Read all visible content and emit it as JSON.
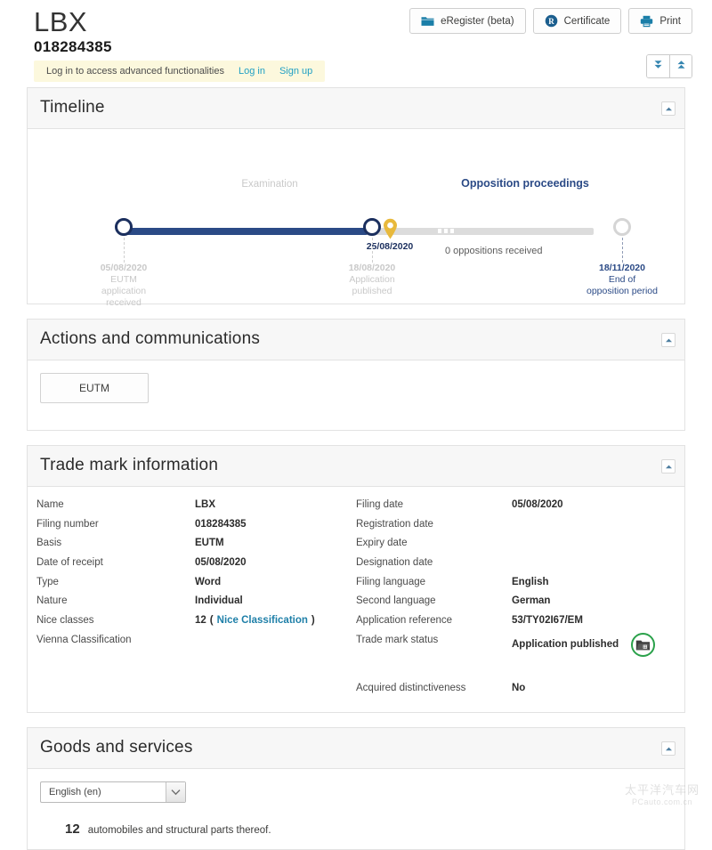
{
  "header": {
    "mark_name": "LBX",
    "mark_number": "018284385",
    "buttons": [
      {
        "label": "eRegister (beta)",
        "icon": "folder-icon"
      },
      {
        "label": "Certificate",
        "icon": "registered-r-icon"
      },
      {
        "label": "Print",
        "icon": "printer-icon"
      }
    ]
  },
  "login_banner": {
    "message": "Log in to access advanced functionalities",
    "login_label": "Log in",
    "signup_label": "Sign up"
  },
  "expand_controls": {
    "expand_all": "expand-all-icon",
    "collapse_all": "collapse-all-icon"
  },
  "panels": {
    "timeline": {
      "title": "Timeline",
      "toggle_icon": "collapse-chevron-up-icon"
    },
    "actions": {
      "title": "Actions and communications",
      "toggle_icon": "collapse-chevron-up-icon"
    },
    "trademark": {
      "title": "Trade mark information",
      "toggle_icon": "collapse-chevron-up-icon"
    },
    "goods": {
      "title": "Goods and services",
      "toggle_icon": "collapse-chevron-up-icon"
    }
  },
  "timeline": {
    "phases": [
      {
        "label": "Examination",
        "state": "done"
      },
      {
        "label": "Opposition proceedings",
        "state": "current"
      }
    ],
    "current_marker": {
      "date": "25/08/2020",
      "icon": "map-pin-icon"
    },
    "note": "0 oppositions received",
    "milestones": [
      {
        "date": "05/08/2020",
        "line1": "EUTM",
        "line2": "application",
        "line3": "received",
        "state": "done"
      },
      {
        "date": "18/08/2020",
        "line1": "Application",
        "line2": "published",
        "line3": "",
        "state": "done"
      },
      {
        "date": "18/11/2020",
        "line1": "End of",
        "line2": "opposition period",
        "line3": "",
        "state": "future"
      }
    ]
  },
  "actions": {
    "buttons": [
      {
        "label": "EUTM"
      }
    ]
  },
  "trademark_info": {
    "left": [
      {
        "label": "Name",
        "value": "LBX"
      },
      {
        "label": "Filing number",
        "value": "018284385"
      },
      {
        "label": "Basis",
        "value": "EUTM"
      },
      {
        "label": "Date of receipt",
        "value": "05/08/2020"
      },
      {
        "label": "Type",
        "value": "Word"
      },
      {
        "label": "Nature",
        "value": "Individual"
      },
      {
        "label": "Nice classes",
        "value": "12",
        "link_prefix": "(",
        "link": "Nice Classification",
        "link_suffix": ")"
      },
      {
        "label": "Vienna Classification",
        "value": ""
      }
    ],
    "right": [
      {
        "label": "Filing date",
        "value": "05/08/2020"
      },
      {
        "label": "Registration date",
        "value": ""
      },
      {
        "label": "Expiry date",
        "value": ""
      },
      {
        "label": "Designation date",
        "value": ""
      },
      {
        "label": "Filing language",
        "value": "English"
      },
      {
        "label": "Second language",
        "value": "German"
      },
      {
        "label": "Application reference",
        "value": "53/TY02I67/EM"
      },
      {
        "label": "Trade mark status",
        "value": "Application published",
        "icon": "published-folder-icon"
      },
      {
        "label": "",
        "value": ""
      },
      {
        "label": "Acquired distinctiveness",
        "value": "No"
      }
    ]
  },
  "goods_services": {
    "language_selected": "English (en)",
    "items": [
      {
        "class": "12",
        "text": "automobiles and structural parts thereof."
      }
    ]
  },
  "watermark": {
    "cn": "太平洋汽车网",
    "en": "PCauto.com.cn"
  },
  "colors": {
    "accent_blue": "#2b4a86",
    "link_blue": "#1e7fa8",
    "banner_yellow": "#fcf8dd",
    "status_green": "#2aa14a",
    "pin_gold": "#e8b93c"
  }
}
